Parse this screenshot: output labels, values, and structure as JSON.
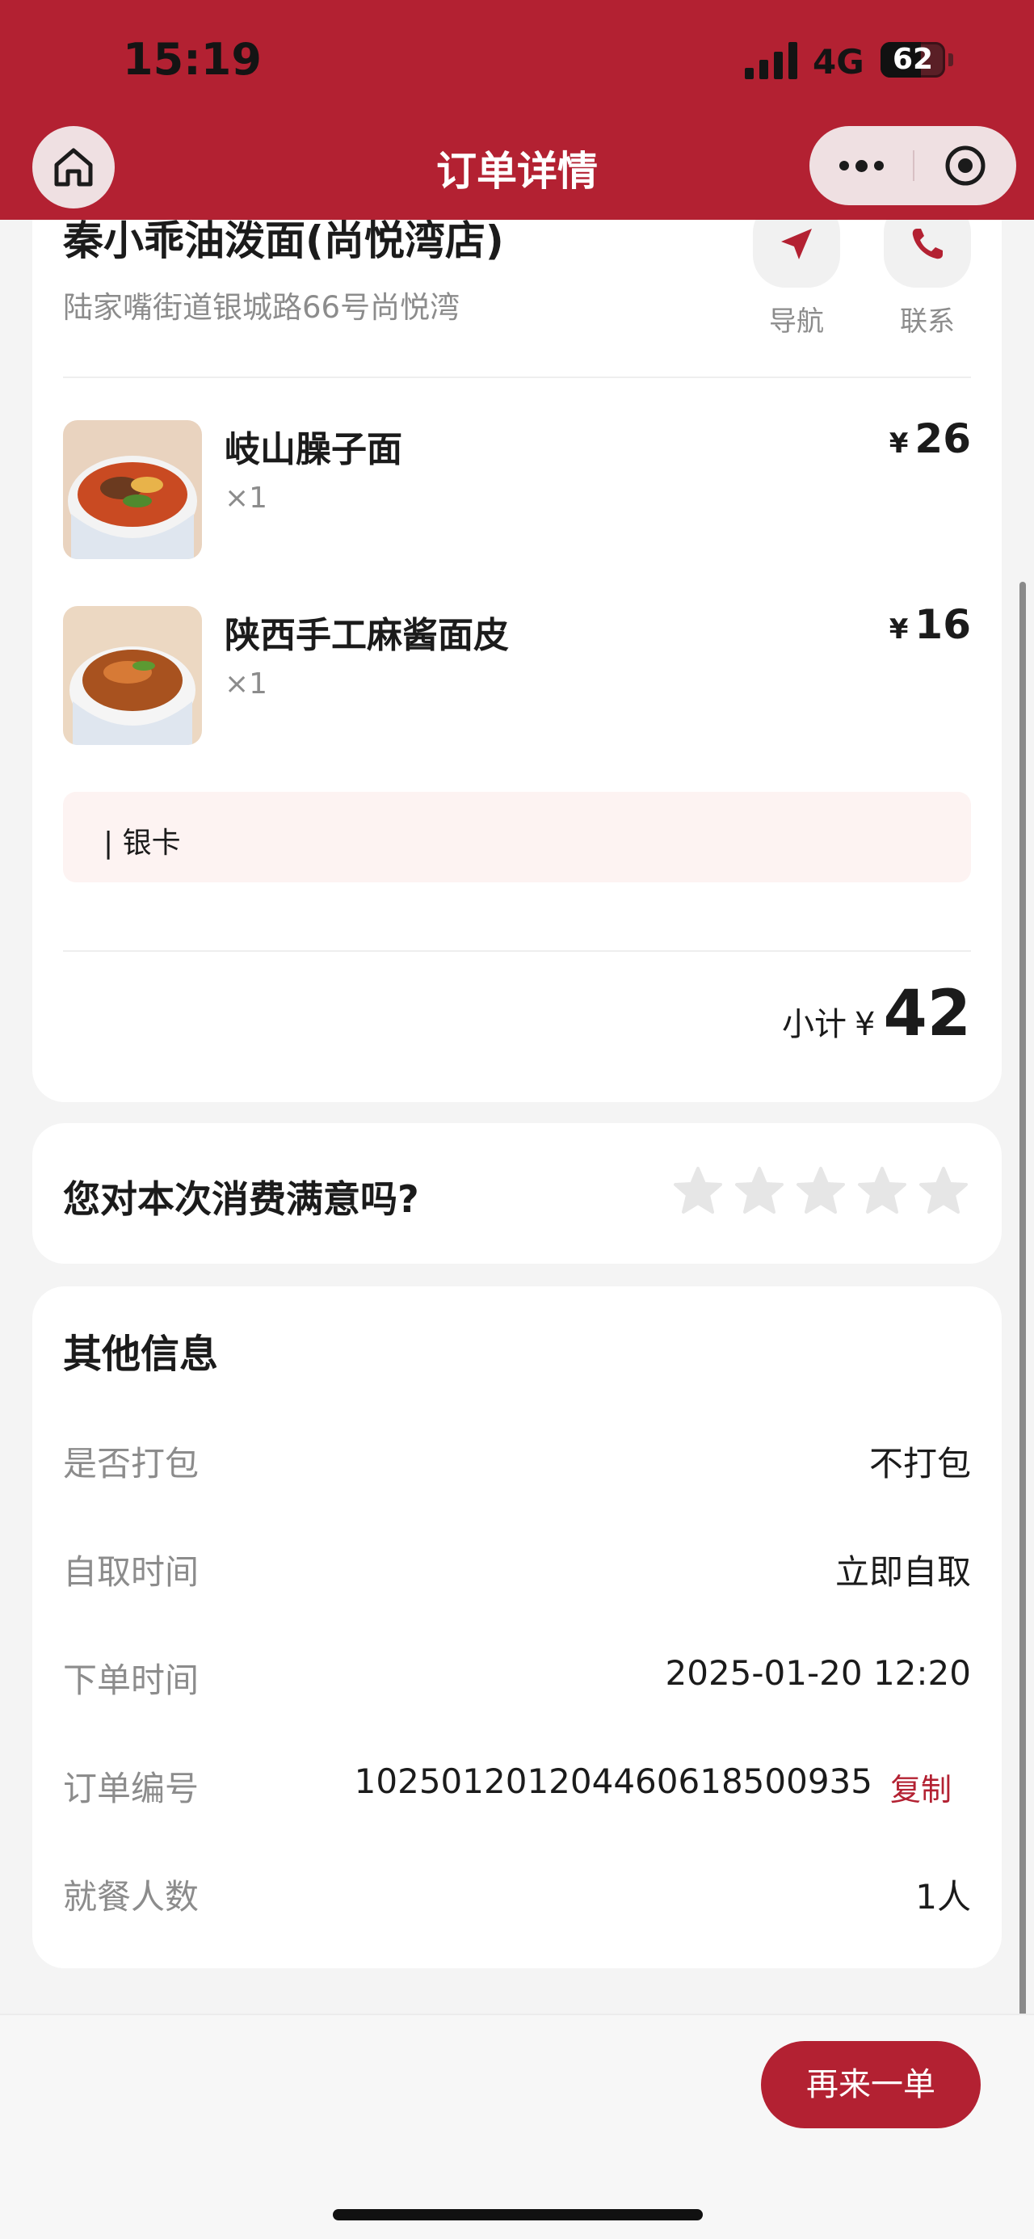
{
  "status_bar": {
    "time": "15:19",
    "network": "4G",
    "battery": "62",
    "battery_level": 0.62
  },
  "nav": {
    "title": "订单详情"
  },
  "store": {
    "name": "秦小乖油泼面(尚悦湾店)",
    "address": "陆家嘴街道银城路66号尚悦湾",
    "navigate_label": "导航",
    "contact_label": "联系"
  },
  "items": [
    {
      "name": "岐山臊子面",
      "qty": "×1",
      "currency": "¥",
      "price": "26"
    },
    {
      "name": "陕西手工麻酱面皮",
      "qty": "×1",
      "currency": "¥",
      "price": "16"
    }
  ],
  "remark": "| 银卡",
  "subtotal": {
    "label": "小计",
    "currency": "¥",
    "amount": "42"
  },
  "rating": {
    "question": "您对本次消费满意吗?",
    "stars": 5,
    "selected": 0
  },
  "info": {
    "title": "其他信息",
    "rows": [
      {
        "key": "是否打包",
        "value": "不打包"
      },
      {
        "key": "自取时间",
        "value": "立即自取"
      },
      {
        "key": "下单时间",
        "value": "2025-01-20 12:20"
      },
      {
        "key": "订单编号",
        "value": "10250120120446061850093​5",
        "copy": "复制"
      },
      {
        "key": "就餐人数",
        "value": "1人"
      }
    ]
  },
  "bottom": {
    "reorder_label": "再来一单"
  },
  "colors": {
    "brand": "#b32132",
    "remark_bg": "#fdf3f2"
  }
}
